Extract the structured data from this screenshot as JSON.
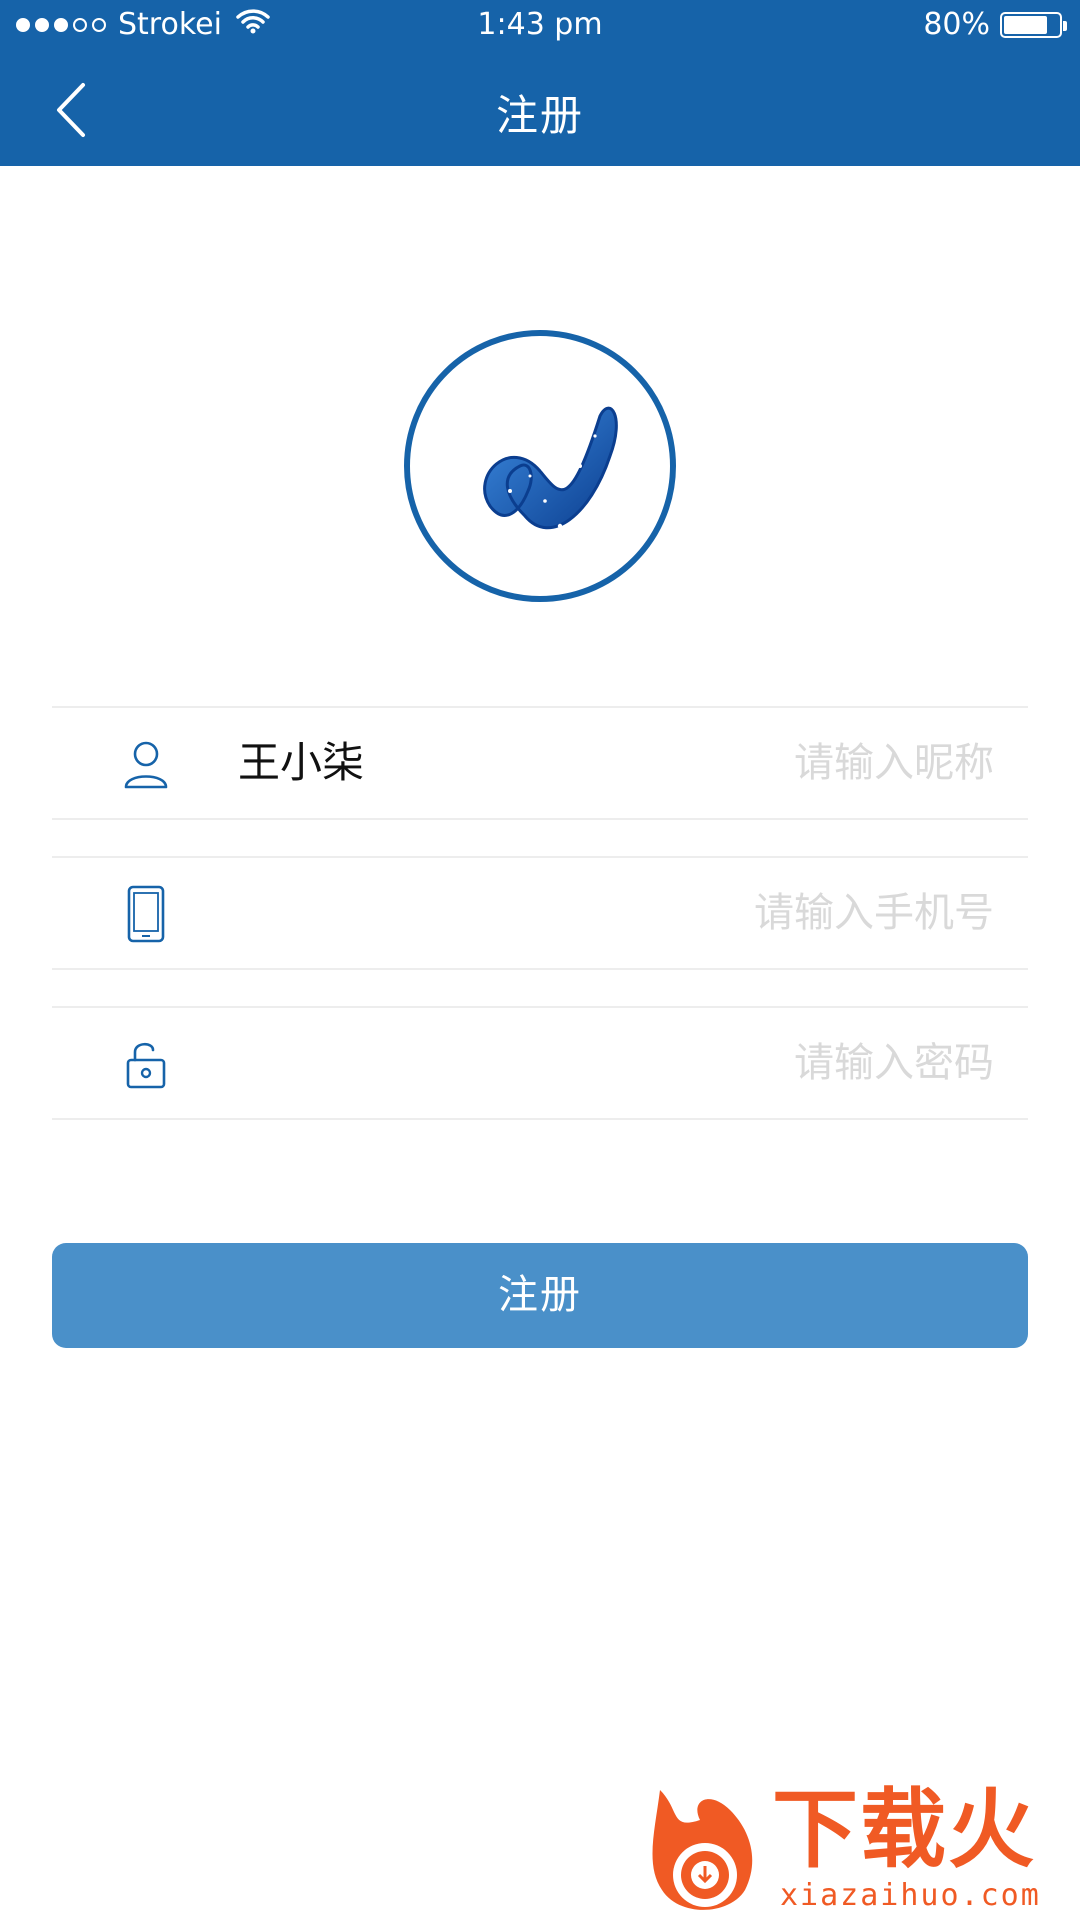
{
  "status_bar": {
    "carrier": "Strokei",
    "time": "1:43 pm",
    "battery": "80%",
    "battery_level": 0.8,
    "signal_bars_filled": 3,
    "signal_bars_total": 5
  },
  "nav": {
    "title": "注册",
    "back_icon": "chevron-left-icon"
  },
  "colors": {
    "header": "#1663A9",
    "button": "#4A90C9",
    "placeholder": "#D9D9D9",
    "watermark": "#F05A24"
  },
  "logo": {
    "icon": "app-logo-icon"
  },
  "form": {
    "nickname": {
      "icon": "user-icon",
      "value": "王小柒",
      "placeholder": "请输入昵称"
    },
    "phone": {
      "icon": "phone-icon",
      "value": "",
      "placeholder": "请输入手机号"
    },
    "password": {
      "icon": "unlock-icon",
      "value": "",
      "placeholder": "请输入密码"
    }
  },
  "register_button": {
    "label": "注册"
  },
  "watermark": {
    "text": "下载火",
    "sub": "xiazaihuo.com"
  }
}
